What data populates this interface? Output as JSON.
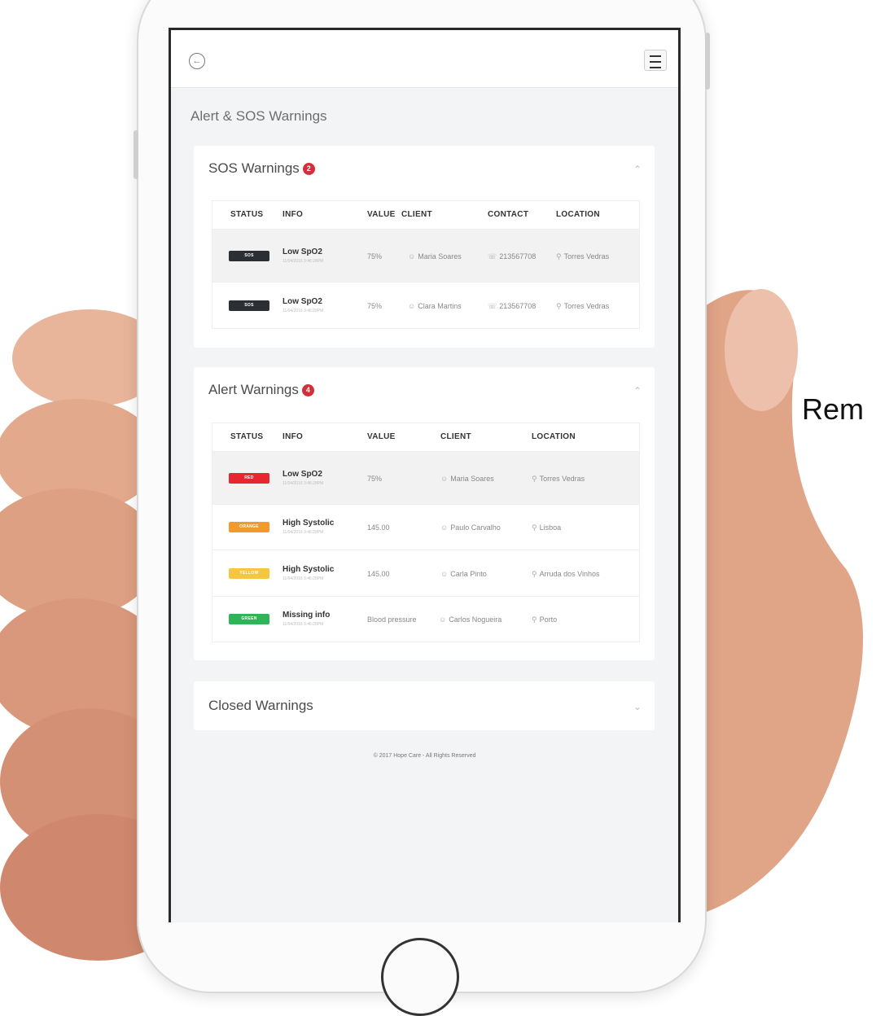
{
  "side_text": "Rem",
  "page_title": "Alert & SOS Warnings",
  "colors": {
    "sos": "#2b2f33",
    "red": "#e8262f",
    "orange": "#f39a2d",
    "yellow": "#f7c63f",
    "green": "#2fb457",
    "badge": "#d32f3a"
  },
  "sos": {
    "title": "SOS Warnings",
    "badge": "2",
    "headers": {
      "status": "STATUS",
      "info": "INFO",
      "value": "VALUE",
      "client": "CLIENT",
      "contact": "CONTACT",
      "location": "LOCATION"
    },
    "rows": [
      {
        "status": "SOS",
        "info": "Low SpO2",
        "date": "11/04/2016 3:46:28PM",
        "value": "75%",
        "client": "Maria Soares",
        "contact": "213567708",
        "location": "Torres Vedras"
      },
      {
        "status": "SOS",
        "info": "Low SpO2",
        "date": "11/04/2016 3:46:28PM",
        "value": "75%",
        "client": "Clara Martins",
        "contact": "213567708",
        "location": "Torres Vedras"
      }
    ]
  },
  "alert": {
    "title": "Alert Warnings",
    "badge": "4",
    "headers": {
      "status": "STATUS",
      "info": "INFO",
      "value": "VALUE",
      "client": "CLIENT",
      "location": "LOCATION"
    },
    "rows": [
      {
        "status": "RED",
        "color": "red",
        "info": "Low SpO2",
        "date": "11/04/2016 3:46:28PM",
        "value": "75%",
        "client": "Maria Soares",
        "location": "Torres Vedras"
      },
      {
        "status": "ORANGE",
        "color": "orange",
        "info": "High Systolic",
        "date": "11/04/2016 3:46:28PM",
        "value": "145.00",
        "client": "Paulo Carvalho",
        "location": "Lisboa"
      },
      {
        "status": "YELLOW",
        "color": "yellow",
        "info": "High Systolic",
        "date": "11/04/2016 3:46:28PM",
        "value": "145.00",
        "client": "Carla Pinto",
        "location": "Arruda dos Vinhos"
      },
      {
        "status": "GREEN",
        "color": "green",
        "info": "Missing info",
        "date": "11/04/2016 3:46:28PM",
        "value": "Blood pressure",
        "client": "Carlos Nogueira",
        "location": "Porto"
      }
    ]
  },
  "closed": {
    "title": "Closed Warnings"
  },
  "footer": "© 2017 Hope Care - All Rights Reserved",
  "icons": {
    "back": "back-arrow-circle-icon",
    "menu": "hamburger-menu-icon",
    "client": "user-icon",
    "contact": "phone-icon",
    "location": "map-pin-icon",
    "collapse": "chevron-up-icon",
    "expand": "chevron-down-icon"
  }
}
